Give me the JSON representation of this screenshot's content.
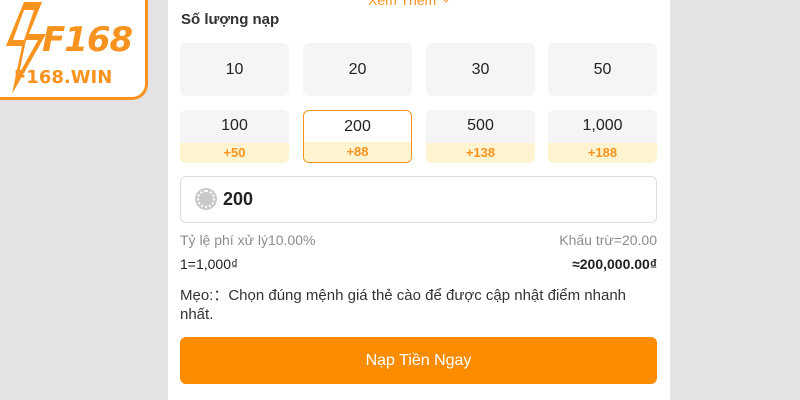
{
  "logo": {
    "brand": "F168",
    "domain": "F168.WIN",
    "accent_color": "#f7931e"
  },
  "see_more": {
    "label": "Xem Thêm",
    "icon": "chevron-down-icon"
  },
  "section_title": "Số lượng nạp",
  "amounts": [
    {
      "value": "10"
    },
    {
      "value": "20"
    },
    {
      "value": "30"
    },
    {
      "value": "50"
    },
    {
      "value": "100",
      "bonus": "+50"
    },
    {
      "value": "200",
      "bonus": "+88",
      "selected": true
    },
    {
      "value": "500",
      "bonus": "+138"
    },
    {
      "value": "1,000",
      "bonus": "+188"
    }
  ],
  "input": {
    "value": "200",
    "icon": "coin-icon"
  },
  "fee": {
    "label": "Tỷ lệ phí xử lý10.00%",
    "deduction": "Khấu trừ=20.00"
  },
  "rate": {
    "label": "1=1,000₫",
    "total": "≈200,000.00₫"
  },
  "tip": "Mẹo:：Chọn đúng mệnh giá thẻ cào để được cập nhật điểm nhanh nhất.",
  "cta": {
    "label": "Nạp Tiền Ngay",
    "color": "#fb8c00"
  }
}
